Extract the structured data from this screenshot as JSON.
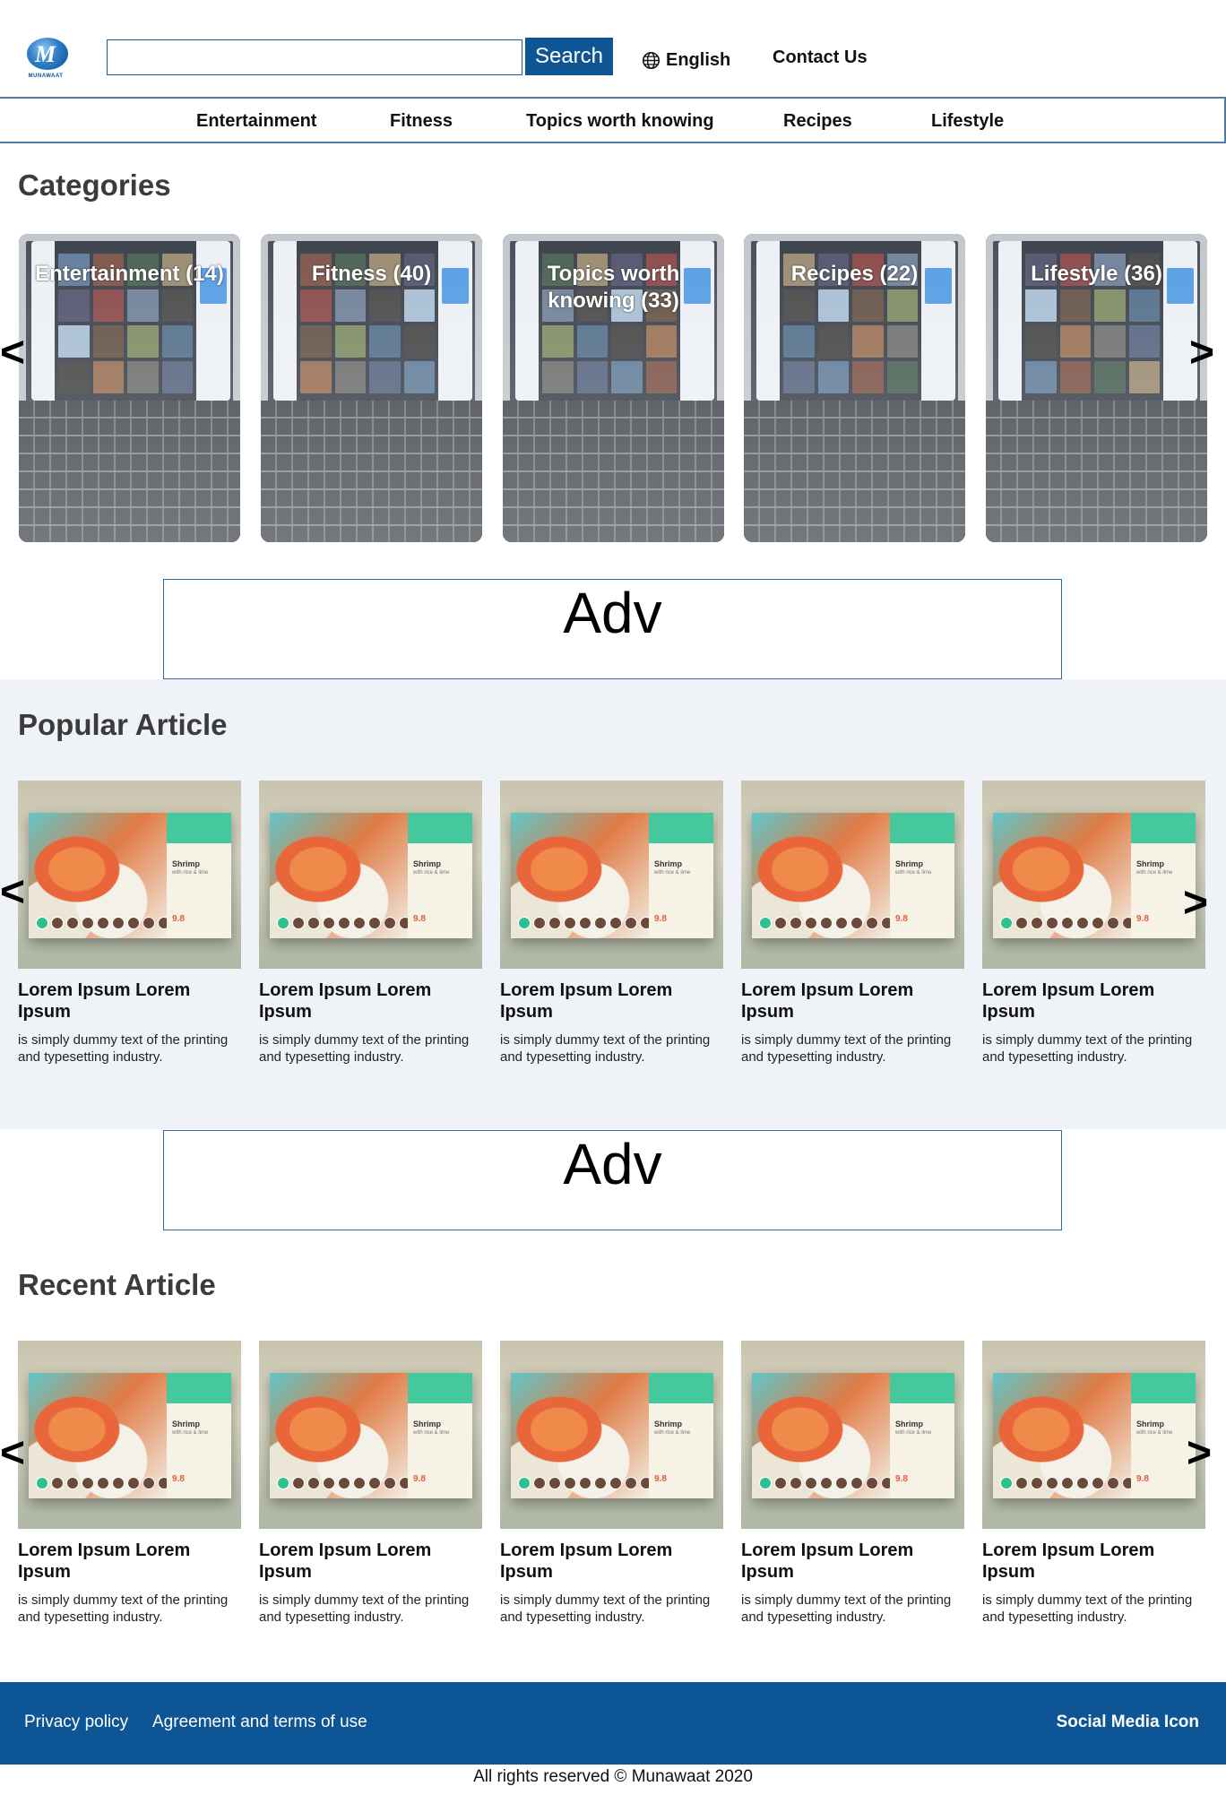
{
  "header": {
    "logo_text": "MUNAWAAT",
    "logo_letter": "M",
    "search_placeholder": "",
    "search_button": "Search",
    "language": "English",
    "contact": "Contact Us"
  },
  "nav": [
    "Entertainment",
    "Fitness",
    "Topics worth knowing",
    "Recipes",
    "Lifestyle"
  ],
  "categories": {
    "title": "Categories",
    "items": [
      {
        "label": "Entertainment (14)"
      },
      {
        "label": "Fitness (40)"
      },
      {
        "label": "Topics worth knowing (33)"
      },
      {
        "label": "Recipes (22)"
      },
      {
        "label": "Lifestyle (36)"
      }
    ],
    "prev": "<",
    "next": ">"
  },
  "adv": {
    "label": "Adv"
  },
  "popular": {
    "title": "Popular Article",
    "prev": "<",
    "next": ">",
    "items": [
      {
        "title": "Lorem Ipsum Lorem Ipsum",
        "desc": " is simply dummy text of the printing and typesetting industry."
      },
      {
        "title": "Lorem Ipsum Lorem Ipsum",
        "desc": " is simply dummy text of the printing and typesetting industry."
      },
      {
        "title": "Lorem Ipsum Lorem Ipsum",
        "desc": " is simply dummy text of the printing and typesetting industry."
      },
      {
        "title": "Lorem Ipsum Lorem Ipsum",
        "desc": " is simply dummy text of the printing and typesetting industry."
      },
      {
        "title": "Lorem Ipsum Lorem Ipsum",
        "desc": " is simply dummy text of the printing and typesetting industry."
      }
    ]
  },
  "recent": {
    "title": "Recent Article",
    "prev": "<",
    "next": ">",
    "items": [
      {
        "title": "Lorem Ipsum Lorem Ipsum",
        "desc": " is simply dummy text of the printing and typesetting industry."
      },
      {
        "title": "Lorem Ipsum Lorem Ipsum",
        "desc": " is simply dummy text of the printing and typesetting industry."
      },
      {
        "title": "Lorem Ipsum Lorem Ipsum",
        "desc": " is simply dummy text of the printing and typesetting industry."
      },
      {
        "title": "Lorem Ipsum Lorem Ipsum",
        "desc": " is simply dummy text of the printing and typesetting industry."
      },
      {
        "title": "Lorem Ipsum Lorem Ipsum",
        "desc": " is simply dummy text of the printing and typesetting industry."
      }
    ]
  },
  "recipe_card": {
    "name": "Shrimp",
    "sub": "with rice & lime",
    "rating": "9.8"
  },
  "footer": {
    "privacy": "Privacy policy",
    "terms": "Agreement and terms of use",
    "social": "Social Media Icon",
    "copyright": "All rights reserved © Munawaat 2020"
  },
  "colors": {
    "brand": "#0d5594",
    "popular_bg": "#eff3f7",
    "nav_border": "#4d7ca8"
  }
}
